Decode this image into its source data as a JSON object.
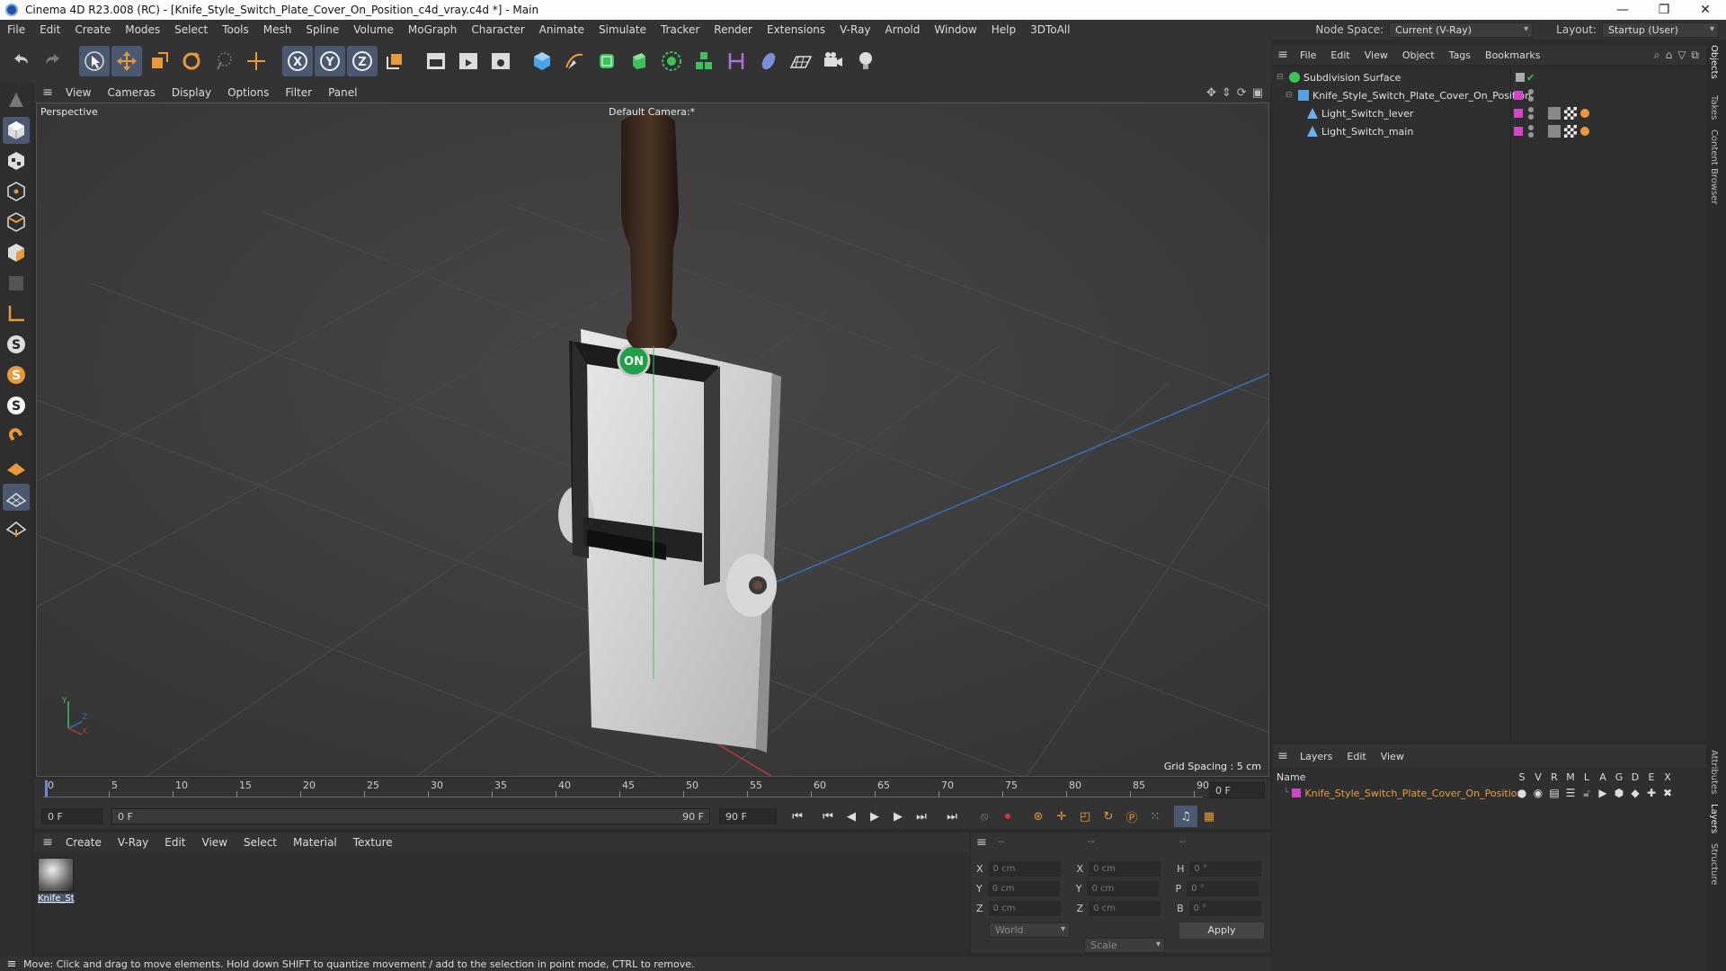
{
  "window": {
    "title": "Cinema 4D R23.008 (RC) - [Knife_Style_Switch_Plate_Cover_On_Position_c4d_vray.c4d *] - Main",
    "controls": [
      "—",
      "❐",
      "✕"
    ]
  },
  "menubar": {
    "items": [
      "File",
      "Edit",
      "Create",
      "Modes",
      "Select",
      "Tools",
      "Mesh",
      "Spline",
      "Volume",
      "MoGraph",
      "Character",
      "Animate",
      "Simulate",
      "Tracker",
      "Render",
      "Extensions",
      "V-Ray",
      "Arnold",
      "Window",
      "Help",
      "3DToAll"
    ],
    "node_space_label": "Node Space:",
    "node_space_value": "Current (V-Ray)",
    "layout_label": "Layout:",
    "layout_value": "Startup (User)"
  },
  "viewport": {
    "menu": [
      "View",
      "Cameras",
      "Display",
      "Options",
      "Filter",
      "Panel"
    ],
    "view_name": "Perspective",
    "camera": "Default Camera:*",
    "grid_spacing": "Grid Spacing : 5 cm",
    "axis_y": "Y",
    "axis_z": "Z",
    "axis_x": "X",
    "badge": "ON"
  },
  "timeline": {
    "ticks": [
      "0",
      "5",
      "10",
      "15",
      "20",
      "25",
      "30",
      "35",
      "40",
      "45",
      "50",
      "55",
      "60",
      "65",
      "70",
      "75",
      "80",
      "85",
      "90"
    ],
    "current_frame_right": "0 F",
    "start_field": "0 F",
    "range_start": "0 F",
    "range_end": "90 F",
    "end_field": "90 F"
  },
  "material_panel": {
    "menu": [
      "Create",
      "V-Ray",
      "Edit",
      "View",
      "Select",
      "Material",
      "Texture"
    ],
    "material_name": "Knife_St"
  },
  "coords": {
    "headers": [
      "--",
      "--",
      "--"
    ],
    "rows": [
      {
        "a": "X",
        "av": "0 cm",
        "b": "X",
        "bv": "0 cm",
        "c": "H",
        "cv": "0 °"
      },
      {
        "a": "Y",
        "av": "0 cm",
        "b": "Y",
        "bv": "0 cm",
        "c": "P",
        "cv": "0 °"
      },
      {
        "a": "Z",
        "av": "0 cm",
        "b": "Z",
        "bv": "0 cm",
        "c": "B",
        "cv": "0 °"
      }
    ],
    "world": "World",
    "scale": "Scale",
    "apply": "Apply"
  },
  "status": {
    "text": "Move: Click and drag to move elements. Hold down SHIFT to quantize movement / add to the selection in point mode, CTRL to remove."
  },
  "objects_panel": {
    "menu": [
      "File",
      "Edit",
      "View",
      "Object",
      "Tags",
      "Bookmarks"
    ],
    "items": [
      {
        "name": "Subdivision Surface"
      },
      {
        "name": "Knife_Style_Switch_Plate_Cover_On_Position"
      },
      {
        "name": "Light_Switch_lever"
      },
      {
        "name": "Light_Switch_main"
      }
    ]
  },
  "layers_panel": {
    "menu": [
      "Layers",
      "Edit",
      "View"
    ],
    "name_header": "Name",
    "flags": [
      "S",
      "V",
      "R",
      "M",
      "L",
      "A",
      "G",
      "D",
      "E",
      "X"
    ],
    "layer_name": "Knife_Style_Switch_Plate_Cover_On_Position"
  },
  "right_tabs": [
    "Objects",
    "Takes",
    "Content Browser",
    "Attributes",
    "Layers",
    "Structure"
  ],
  "colors": {
    "accent": "#4a5870",
    "layer_pink": "#d046c8",
    "layer_text": "#e8a040"
  }
}
